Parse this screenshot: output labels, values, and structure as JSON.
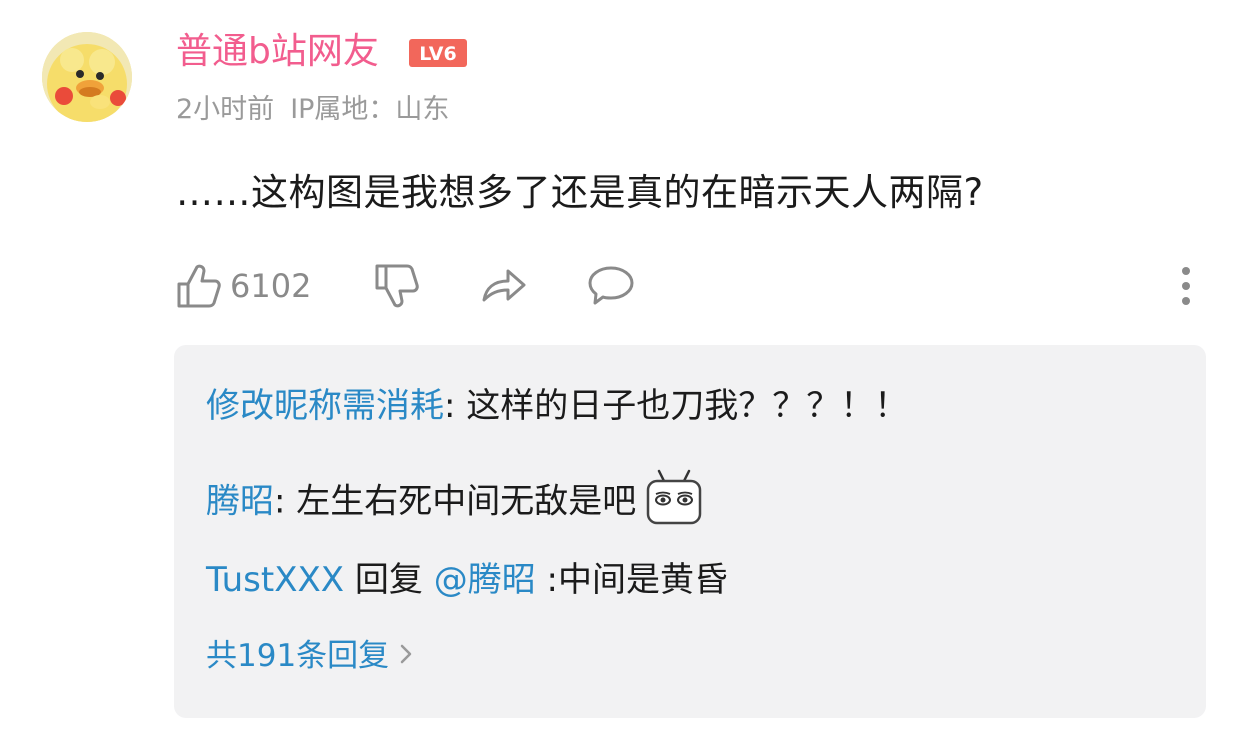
{
  "comment": {
    "username": "普通b站网友",
    "level": "LV6",
    "time": "2小时前",
    "ip_location": "IP属地：山东",
    "text": "……这构图是我想多了还是真的在暗示天人两隔?",
    "like_count": "6102"
  },
  "icons": {
    "avatar": "yellow-duck-avatar",
    "like": "thumbs-up-icon",
    "dislike": "thumbs-down-icon",
    "share": "share-arrow-icon",
    "reply": "chat-bubble-icon",
    "more": "vertical-dots-icon",
    "emoji": "tv-face-emoji",
    "chevron": "chevron-right-icon"
  },
  "colors": {
    "username": "#f25d8e",
    "link": "#2a89c6",
    "level_badge": "#f2675b",
    "reply_panel_bg": "#f2f2f3"
  },
  "replies": [
    {
      "name": "修改昵称需消耗",
      "text": ": 这样的日子也刀我？？？！！"
    },
    {
      "name": "腾昭",
      "text": ": 左生右死中间无敌是吧"
    },
    {
      "name": "TustXXX",
      "mid": " 回复 ",
      "mention": "@腾昭",
      "text": " :中间是黄昏"
    }
  ],
  "more_replies": "共191条回复"
}
